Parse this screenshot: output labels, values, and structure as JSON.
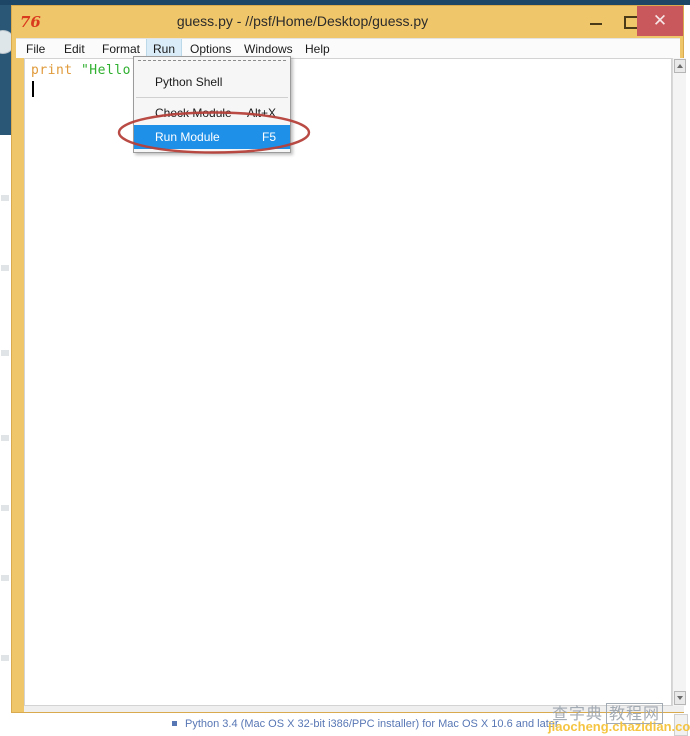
{
  "window": {
    "title": "guess.py - //psf/Home/Desktop/guess.py",
    "icon": "76",
    "icon_name": "python-idle-icon",
    "controls": {
      "minimize_label": "–",
      "maximize_label": "□",
      "close_label": "✕"
    },
    "colors": {
      "titlebar": "#f0c66a",
      "close_button": "#c9585c",
      "menu_highlight": "#d9ecf8",
      "selection": "#1e90e8",
      "annotation": "#b5403a"
    }
  },
  "menu_bar": {
    "items": [
      {
        "label": "File",
        "active": false
      },
      {
        "label": "Edit",
        "active": false
      },
      {
        "label": "Format",
        "active": false
      },
      {
        "label": "Run",
        "active": true
      },
      {
        "label": "Options",
        "active": false
      },
      {
        "label": "Windows",
        "active": false
      },
      {
        "label": "Help",
        "active": false
      }
    ]
  },
  "run_menu": {
    "tearoff": true,
    "items": [
      {
        "label": "Python Shell",
        "accel": "",
        "selected": false
      },
      {
        "label": "Check Module",
        "accel": "Alt+X",
        "selected": false
      },
      {
        "label": "Run Module",
        "accel": "F5",
        "selected": true
      }
    ]
  },
  "editor": {
    "code": {
      "keyword": "print",
      "space": " ",
      "string": "\"Hello\""
    },
    "caret_visible": true
  },
  "scrollbar": {
    "up_arrow": "scroll-up-arrow",
    "down_arrow": "scroll-down-arrow"
  },
  "background": {
    "bottom_text": "Python 3.4 (Mac OS X 32-bit i386/PPC installer) for Mac OS X 10.6 and later"
  },
  "watermark": {
    "cn_left": "查字典",
    "cn_boxed": "教程网",
    "url": "jiaocheng.chazidian.com"
  }
}
